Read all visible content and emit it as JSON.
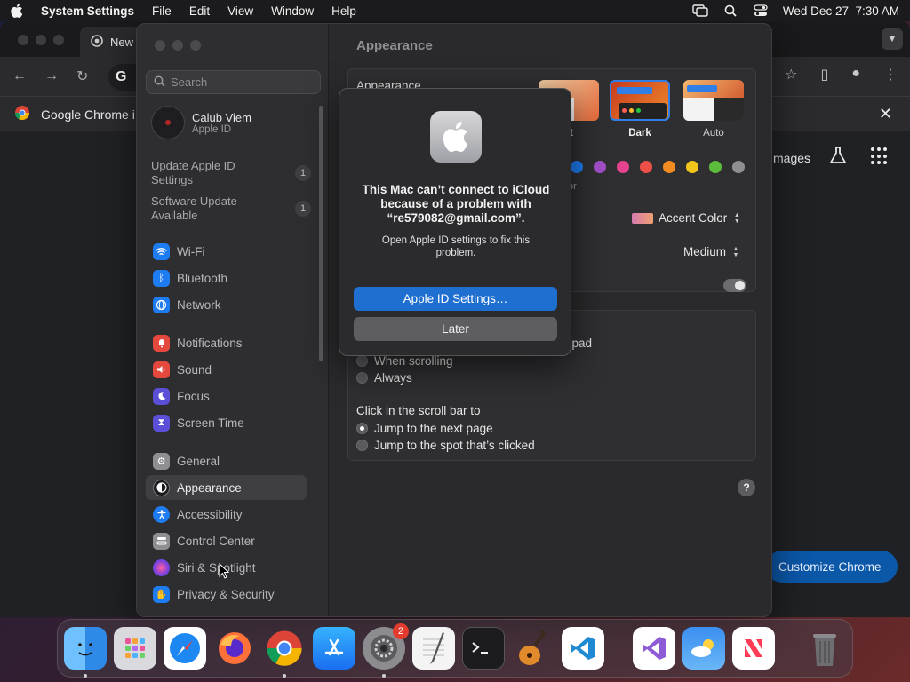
{
  "menubar": {
    "app_name": "System Settings",
    "menus": [
      "File",
      "Edit",
      "View",
      "Window",
      "Help"
    ],
    "clock": "Wed Dec 27  7:30 AM"
  },
  "chrome": {
    "tab_title": "New",
    "infobar_text": "Google Chrome i",
    "images_link": "mages",
    "customize_label": "Customize Chrome"
  },
  "settings": {
    "search_placeholder": "Search",
    "profile": {
      "name": "Calub Viem",
      "subtitle": "Apple ID"
    },
    "notices": [
      {
        "label": "Update Apple ID Settings",
        "count": "1"
      },
      {
        "label": "Software Update Available",
        "count": "1"
      }
    ],
    "sidebar_items": [
      {
        "label": "Wi-Fi",
        "icon": "wifi-icon",
        "color": "#1e7cf2"
      },
      {
        "label": "Bluetooth",
        "icon": "bluetooth-icon",
        "color": "#1e7cf2"
      },
      {
        "label": "Network",
        "icon": "globe-icon",
        "color": "#1e7cf2"
      },
      {
        "label": "Notifications",
        "icon": "bell-icon",
        "color": "#e5483d"
      },
      {
        "label": "Sound",
        "icon": "speaker-icon",
        "color": "#e5483d"
      },
      {
        "label": "Focus",
        "icon": "moon-icon",
        "color": "#5a4fd6"
      },
      {
        "label": "Screen Time",
        "icon": "hourglass-icon",
        "color": "#5a4fd6"
      },
      {
        "label": "General",
        "icon": "gear-icon",
        "color": "#8e8e93"
      },
      {
        "label": "Appearance",
        "icon": "appearance-icon",
        "color": "#2c2c2e"
      },
      {
        "label": "Accessibility",
        "icon": "accessibility-icon",
        "color": "#1e7cf2"
      },
      {
        "label": "Control Center",
        "icon": "control-center-icon",
        "color": "#8e8e93"
      },
      {
        "label": "Siri & Spotlight",
        "icon": "siri-icon",
        "color": "#b53fd4"
      },
      {
        "label": "Privacy & Security",
        "icon": "hand-icon",
        "color": "#1e7cf2"
      }
    ],
    "selected_item": "Appearance",
    "content": {
      "page_title": "Appearance",
      "appearance_label": "Appearance",
      "theme_labels": [
        "nt",
        "Dark",
        "Auto"
      ],
      "selected_theme": "Dark",
      "accent_colors": [
        "#1e7cf2",
        "#a24fc8",
        "#e6438e",
        "#ec4f47",
        "#f18b22",
        "#f2c51d",
        "#5cbd3c",
        "#8e8e93"
      ],
      "accent_caption": "or",
      "highlight_label": "Accent Color",
      "sidebar_icon_size": "Medium",
      "scroll_row_fragment": "ckpad",
      "scroll_options": [
        "When scrolling",
        "Always"
      ],
      "click_title": "Click in the scroll bar to",
      "click_options": [
        "Jump to the next page",
        "Jump to the spot that’s clicked"
      ],
      "help": "?"
    }
  },
  "alert": {
    "title": "This Mac can’t connect to iCloud because of a problem with “re579082@gmail.com”.",
    "message": "Open Apple ID settings to fix this problem.",
    "primary_button": "Apple ID Settings…",
    "secondary_button": "Later"
  },
  "dock": {
    "apps": [
      "Finder",
      "Launchpad",
      "Safari",
      "Firefox",
      "Google Chrome",
      "App Store",
      "System Settings",
      "TextEdit",
      "Terminal",
      "GarageBand",
      "Visual Studio Code",
      "Visual Studio",
      "Weather",
      "News",
      "Trash"
    ],
    "badge": "2"
  }
}
